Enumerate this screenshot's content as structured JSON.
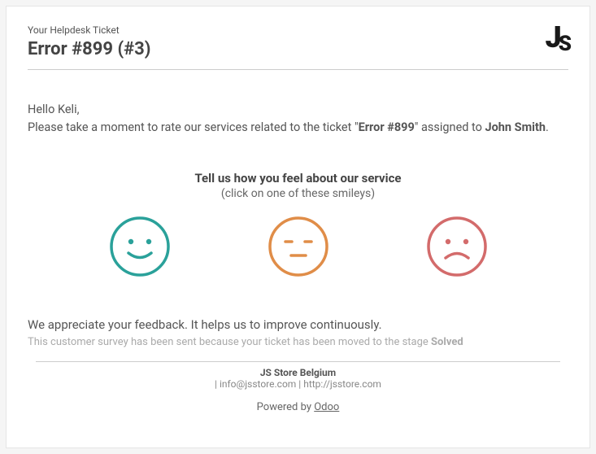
{
  "header": {
    "subtitle": "Your Helpdesk Ticket",
    "title": "Error #899 (#3)",
    "logo_text_j": "J",
    "logo_text_s": "S"
  },
  "greeting": {
    "hello_prefix": "Hello ",
    "recipient_name": "Keli",
    "hello_suffix": ",",
    "line2_prefix": "Please take a moment to rate our services related to the ticket \"",
    "ticket_name": "Error #899",
    "line2_mid": "\" assigned to ",
    "assignee": "John Smith",
    "line2_suffix": "."
  },
  "rating": {
    "title": "Tell us how you feel about our service",
    "sub": "(click on one of these smileys)"
  },
  "smileys": {
    "happy_color": "#2aa19a",
    "neutral_color": "#e08d48",
    "sad_color": "#d36b6b"
  },
  "appreciate": "We appreciate your feedback. It helps us to improve continuously.",
  "survey_reason": {
    "prefix": "This customer survey has been sent because your ticket has been moved to the stage ",
    "stage": "Solved"
  },
  "company": {
    "name": "JS Store Belgium",
    "sep1": " | ",
    "email": "info@jsstore.com",
    "sep2": " | ",
    "website": "http://jsstore.com"
  },
  "powered": {
    "prefix": "Powered by ",
    "brand": "Odoo"
  }
}
